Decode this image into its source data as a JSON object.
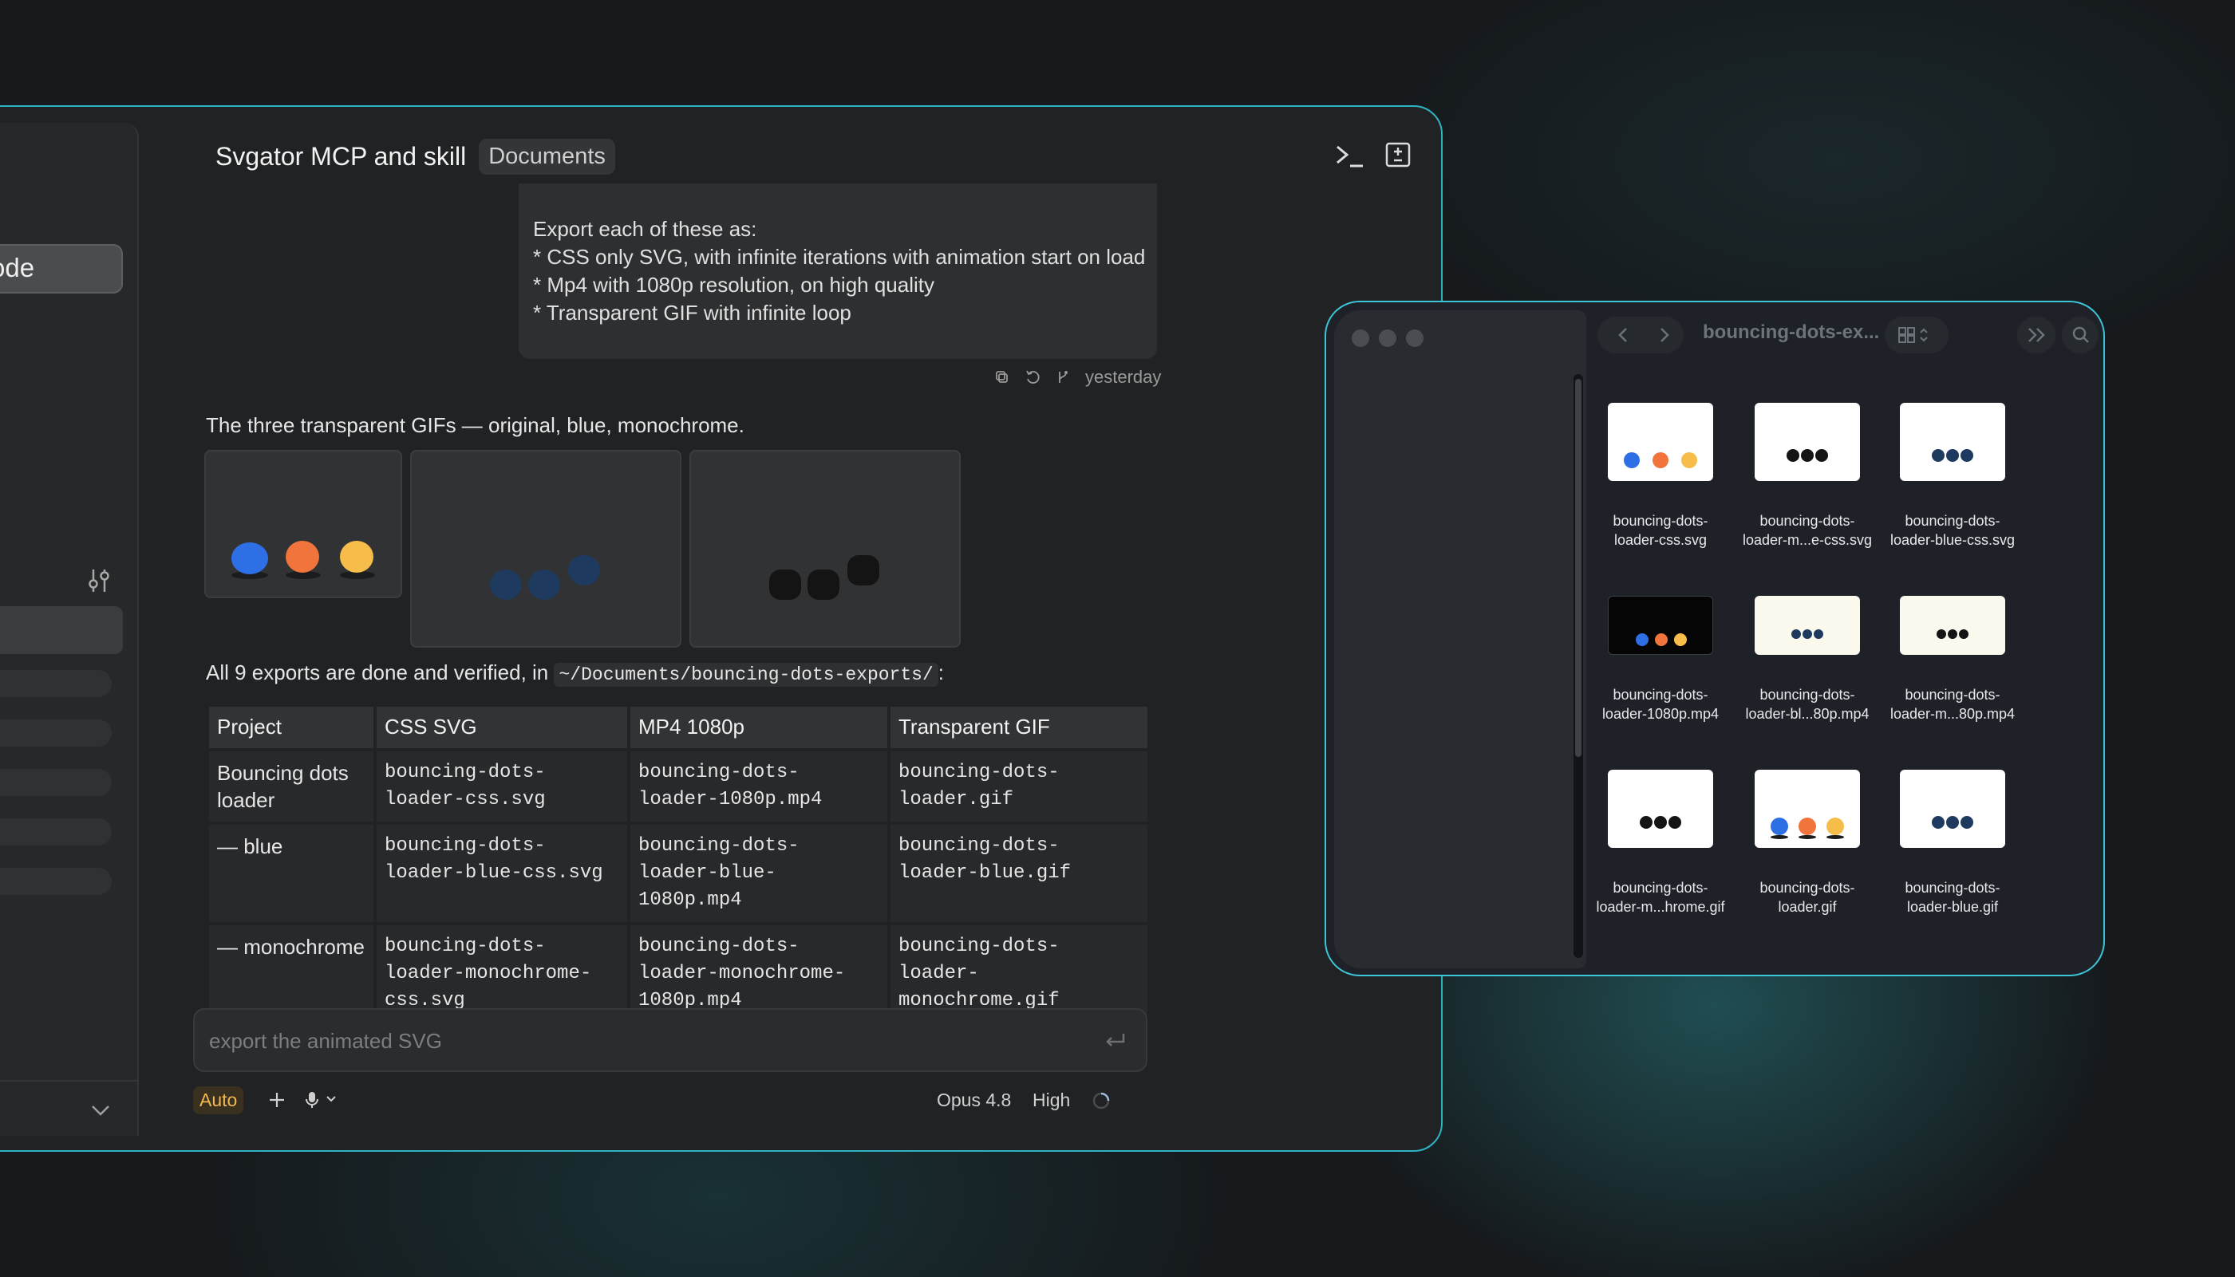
{
  "chat": {
    "sidebar": {
      "active_item_label": "ode"
    },
    "title": "Svgator MCP and skill",
    "badge": "Documents",
    "user_message": {
      "lines": [
        "Export each of these as:",
        "",
        "* CSS only SVG, with infinite iterations with animation start on load",
        "* Mp4 with 1080p resolution, on high quality",
        "* Transparent GIF with infinite loop"
      ],
      "timestamp": "yesterday"
    },
    "gifs_text": "The three transparent GIFs — original, blue, monochrome.",
    "exports_prefix": "All 9 exports are done and verified, in ",
    "exports_path": "~/Documents/bouncing-dots-exports/",
    "exports_suffix": ":",
    "table": {
      "headers": [
        "Project",
        "CSS SVG",
        "MP4 1080p",
        "Transparent GIF"
      ],
      "rows": [
        [
          "Bouncing dots loader",
          "bouncing-dots-loader-css.svg",
          "bouncing-dots-loader-1080p.mp4",
          "bouncing-dots-loader.gif"
        ],
        [
          "— blue",
          "bouncing-dots-loader-blue-css.svg",
          "bouncing-dots-loader-blue-1080p.mp4",
          "bouncing-dots-loader-blue.gif"
        ],
        [
          "— monochrome",
          "bouncing-dots-loader-monochrome-css.svg",
          "bouncing-dots-loader-monochrome-1080p.mp4",
          "bouncing-dots-loader-monochrome.gif"
        ]
      ]
    },
    "input": {
      "placeholder": "export the animated SVG"
    },
    "mode_badge": "Auto",
    "model": "Opus 4.8",
    "effort": "High"
  },
  "finder": {
    "title": "bouncing-dots-ex...",
    "files": [
      {
        "line1": "bouncing-dots-",
        "line2": "loader-css.svg"
      },
      {
        "line1": "bouncing-dots-",
        "line2": "loader-m...e-css.svg"
      },
      {
        "line1": "bouncing-dots-",
        "line2": "loader-blue-css.svg"
      },
      {
        "line1": "bouncing-dots-",
        "line2": "loader-1080p.mp4"
      },
      {
        "line1": "bouncing-dots-",
        "line2": "loader-bl...80p.mp4"
      },
      {
        "line1": "bouncing-dots-",
        "line2": "loader-m...80p.mp4"
      },
      {
        "line1": "bouncing-dots-",
        "line2": "loader-m...hrome.gif"
      },
      {
        "line1": "bouncing-dots-",
        "line2": "loader.gif"
      },
      {
        "line1": "bouncing-dots-",
        "line2": "loader-blue.gif"
      }
    ]
  },
  "colors": {
    "accent_border": "#2fb2c4",
    "dot_blue": "#2f6fe6",
    "dot_orange": "#f0743c",
    "dot_yellow": "#f6bd4a",
    "dot_navy": "#1e3a5f",
    "dot_black": "#141414",
    "auto_badge_text": "#f0b850"
  },
  "icons": [
    "terminal-icon",
    "diff-icon",
    "copy-icon",
    "retry-icon",
    "branch-icon",
    "filter-sliders-icon",
    "chevron-down-icon",
    "enter-icon",
    "plus-icon",
    "microphone-icon",
    "spinner-icon",
    "back-arrow-icon",
    "forward-arrow-icon",
    "grid-view-icon",
    "double-chevron-icon",
    "search-icon"
  ]
}
